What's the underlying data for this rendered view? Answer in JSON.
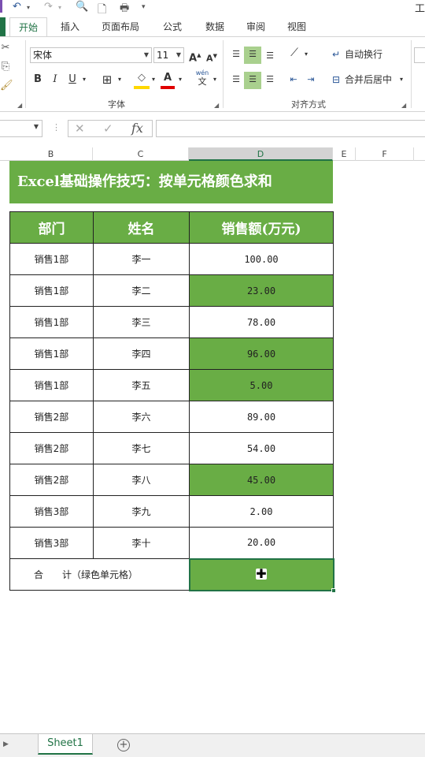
{
  "qat": {
    "undo_icon": "↶",
    "redo_icon": "↷",
    "window_title_fragment": "工"
  },
  "ribbon_tabs": [
    "开始",
    "插入",
    "页面布局",
    "公式",
    "数据",
    "审阅",
    "视图"
  ],
  "active_tab": "开始",
  "font_group": {
    "font_name": "宋体",
    "font_size": "11",
    "grow_label": "A",
    "shrink_label": "A",
    "bold": "B",
    "italic": "I",
    "underline": "U",
    "font_color_label": "A",
    "fill_color_label": "◇",
    "phonetic_label": "wén",
    "phonetic_char": "文",
    "label": "字体"
  },
  "align_group": {
    "wrap_text": "自动换行",
    "merge_center": "合并后居中",
    "label": "对齐方式"
  },
  "formula_bar": {
    "fx_label": "fx",
    "cancel_icon": "✕",
    "enter_icon": "✓"
  },
  "columns": [
    "B",
    "C",
    "D",
    "E",
    "F"
  ],
  "sheet": {
    "banner": "Excel基础操作技巧：按单元格颜色求和",
    "headers": [
      "部门",
      "姓名",
      "销售额(万元)"
    ],
    "rows": [
      {
        "dept": "销售1部",
        "name": "李一",
        "sales": "100.00",
        "green": false
      },
      {
        "dept": "销售1部",
        "name": "李二",
        "sales": "23.00",
        "green": true
      },
      {
        "dept": "销售1部",
        "name": "李三",
        "sales": "78.00",
        "green": false
      },
      {
        "dept": "销售1部",
        "name": "李四",
        "sales": "96.00",
        "green": true
      },
      {
        "dept": "销售1部",
        "name": "李五",
        "sales": "5.00",
        "green": true
      },
      {
        "dept": "销售2部",
        "name": "李六",
        "sales": "89.00",
        "green": false
      },
      {
        "dept": "销售2部",
        "name": "李七",
        "sales": "54.00",
        "green": false
      },
      {
        "dept": "销售2部",
        "name": "李八",
        "sales": "45.00",
        "green": true
      },
      {
        "dept": "销售3部",
        "name": "李九",
        "sales": "2.00",
        "green": false
      },
      {
        "dept": "销售3部",
        "name": "李十",
        "sales": "20.00",
        "green": false
      }
    ],
    "total_label": "合　　计（绿色单元格）"
  },
  "sheet_tabs": {
    "active": "Sheet1",
    "add_icon": "+"
  },
  "colors": {
    "green_fill": "#69ad45",
    "excel_green": "#217346"
  }
}
